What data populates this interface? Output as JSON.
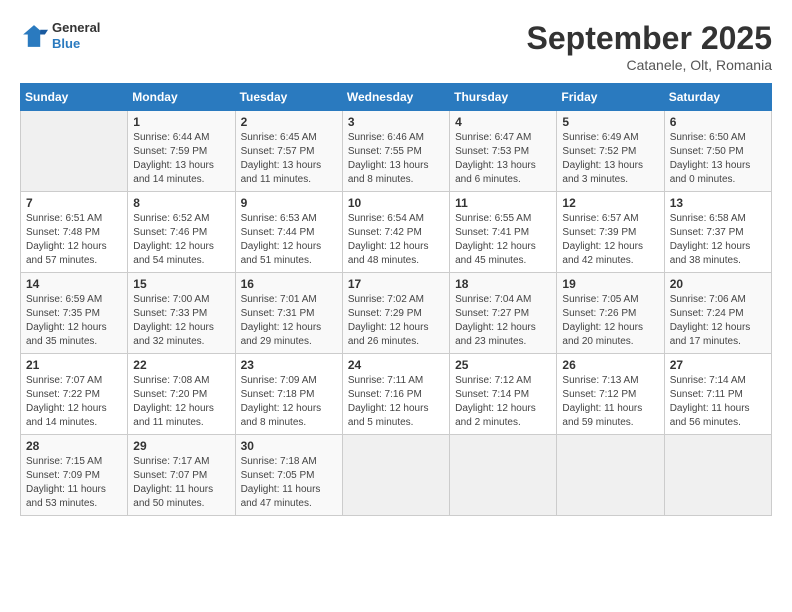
{
  "header": {
    "logo_general": "General",
    "logo_blue": "Blue",
    "month_title": "September 2025",
    "location": "Catanele, Olt, Romania"
  },
  "weekdays": [
    "Sunday",
    "Monday",
    "Tuesday",
    "Wednesday",
    "Thursday",
    "Friday",
    "Saturday"
  ],
  "weeks": [
    [
      {
        "day": "",
        "info": ""
      },
      {
        "day": "1",
        "info": "Sunrise: 6:44 AM\nSunset: 7:59 PM\nDaylight: 13 hours\nand 14 minutes."
      },
      {
        "day": "2",
        "info": "Sunrise: 6:45 AM\nSunset: 7:57 PM\nDaylight: 13 hours\nand 11 minutes."
      },
      {
        "day": "3",
        "info": "Sunrise: 6:46 AM\nSunset: 7:55 PM\nDaylight: 13 hours\nand 8 minutes."
      },
      {
        "day": "4",
        "info": "Sunrise: 6:47 AM\nSunset: 7:53 PM\nDaylight: 13 hours\nand 6 minutes."
      },
      {
        "day": "5",
        "info": "Sunrise: 6:49 AM\nSunset: 7:52 PM\nDaylight: 13 hours\nand 3 minutes."
      },
      {
        "day": "6",
        "info": "Sunrise: 6:50 AM\nSunset: 7:50 PM\nDaylight: 13 hours\nand 0 minutes."
      }
    ],
    [
      {
        "day": "7",
        "info": "Sunrise: 6:51 AM\nSunset: 7:48 PM\nDaylight: 12 hours\nand 57 minutes."
      },
      {
        "day": "8",
        "info": "Sunrise: 6:52 AM\nSunset: 7:46 PM\nDaylight: 12 hours\nand 54 minutes."
      },
      {
        "day": "9",
        "info": "Sunrise: 6:53 AM\nSunset: 7:44 PM\nDaylight: 12 hours\nand 51 minutes."
      },
      {
        "day": "10",
        "info": "Sunrise: 6:54 AM\nSunset: 7:42 PM\nDaylight: 12 hours\nand 48 minutes."
      },
      {
        "day": "11",
        "info": "Sunrise: 6:55 AM\nSunset: 7:41 PM\nDaylight: 12 hours\nand 45 minutes."
      },
      {
        "day": "12",
        "info": "Sunrise: 6:57 AM\nSunset: 7:39 PM\nDaylight: 12 hours\nand 42 minutes."
      },
      {
        "day": "13",
        "info": "Sunrise: 6:58 AM\nSunset: 7:37 PM\nDaylight: 12 hours\nand 38 minutes."
      }
    ],
    [
      {
        "day": "14",
        "info": "Sunrise: 6:59 AM\nSunset: 7:35 PM\nDaylight: 12 hours\nand 35 minutes."
      },
      {
        "day": "15",
        "info": "Sunrise: 7:00 AM\nSunset: 7:33 PM\nDaylight: 12 hours\nand 32 minutes."
      },
      {
        "day": "16",
        "info": "Sunrise: 7:01 AM\nSunset: 7:31 PM\nDaylight: 12 hours\nand 29 minutes."
      },
      {
        "day": "17",
        "info": "Sunrise: 7:02 AM\nSunset: 7:29 PM\nDaylight: 12 hours\nand 26 minutes."
      },
      {
        "day": "18",
        "info": "Sunrise: 7:04 AM\nSunset: 7:27 PM\nDaylight: 12 hours\nand 23 minutes."
      },
      {
        "day": "19",
        "info": "Sunrise: 7:05 AM\nSunset: 7:26 PM\nDaylight: 12 hours\nand 20 minutes."
      },
      {
        "day": "20",
        "info": "Sunrise: 7:06 AM\nSunset: 7:24 PM\nDaylight: 12 hours\nand 17 minutes."
      }
    ],
    [
      {
        "day": "21",
        "info": "Sunrise: 7:07 AM\nSunset: 7:22 PM\nDaylight: 12 hours\nand 14 minutes."
      },
      {
        "day": "22",
        "info": "Sunrise: 7:08 AM\nSunset: 7:20 PM\nDaylight: 12 hours\nand 11 minutes."
      },
      {
        "day": "23",
        "info": "Sunrise: 7:09 AM\nSunset: 7:18 PM\nDaylight: 12 hours\nand 8 minutes."
      },
      {
        "day": "24",
        "info": "Sunrise: 7:11 AM\nSunset: 7:16 PM\nDaylight: 12 hours\nand 5 minutes."
      },
      {
        "day": "25",
        "info": "Sunrise: 7:12 AM\nSunset: 7:14 PM\nDaylight: 12 hours\nand 2 minutes."
      },
      {
        "day": "26",
        "info": "Sunrise: 7:13 AM\nSunset: 7:12 PM\nDaylight: 11 hours\nand 59 minutes."
      },
      {
        "day": "27",
        "info": "Sunrise: 7:14 AM\nSunset: 7:11 PM\nDaylight: 11 hours\nand 56 minutes."
      }
    ],
    [
      {
        "day": "28",
        "info": "Sunrise: 7:15 AM\nSunset: 7:09 PM\nDaylight: 11 hours\nand 53 minutes."
      },
      {
        "day": "29",
        "info": "Sunrise: 7:17 AM\nSunset: 7:07 PM\nDaylight: 11 hours\nand 50 minutes."
      },
      {
        "day": "30",
        "info": "Sunrise: 7:18 AM\nSunset: 7:05 PM\nDaylight: 11 hours\nand 47 minutes."
      },
      {
        "day": "",
        "info": ""
      },
      {
        "day": "",
        "info": ""
      },
      {
        "day": "",
        "info": ""
      },
      {
        "day": "",
        "info": ""
      }
    ]
  ]
}
